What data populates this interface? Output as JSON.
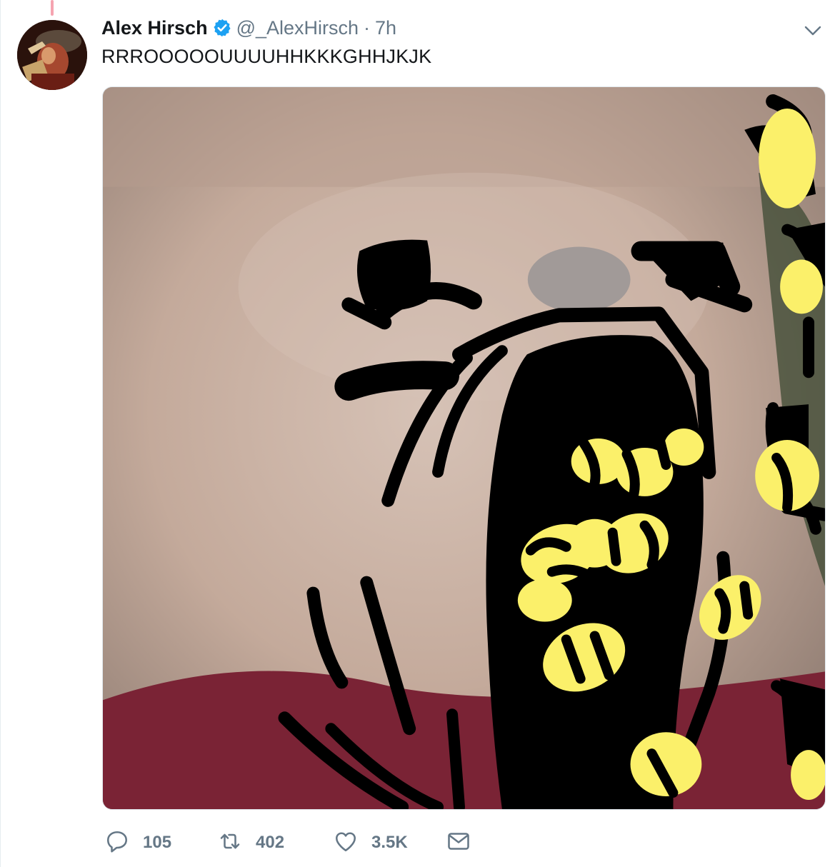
{
  "tweet": {
    "author_name": "Alex Hirsch",
    "handle": "@_AlexHirsch",
    "separator": "·",
    "time": "7h",
    "text": "RRROOOOOUUUUHHKKKGHHJKJK",
    "verified": true
  },
  "actions": {
    "reply_count": "105",
    "retweet_count": "402",
    "like_count": "3.5K"
  },
  "icons": {
    "verified": "verified-badge-icon",
    "menu": "chevron-down-icon",
    "reply": "reply-icon",
    "retweet": "retweet-icon",
    "like": "heart-icon",
    "share": "envelope-icon"
  },
  "colors": {
    "text": "#14171a",
    "secondary": "#657786",
    "verified_blue": "#1da1f2",
    "thread_line": "#f5a4b0",
    "bee_yellow": "#fbf06a",
    "fur": "#c9b0a2"
  }
}
